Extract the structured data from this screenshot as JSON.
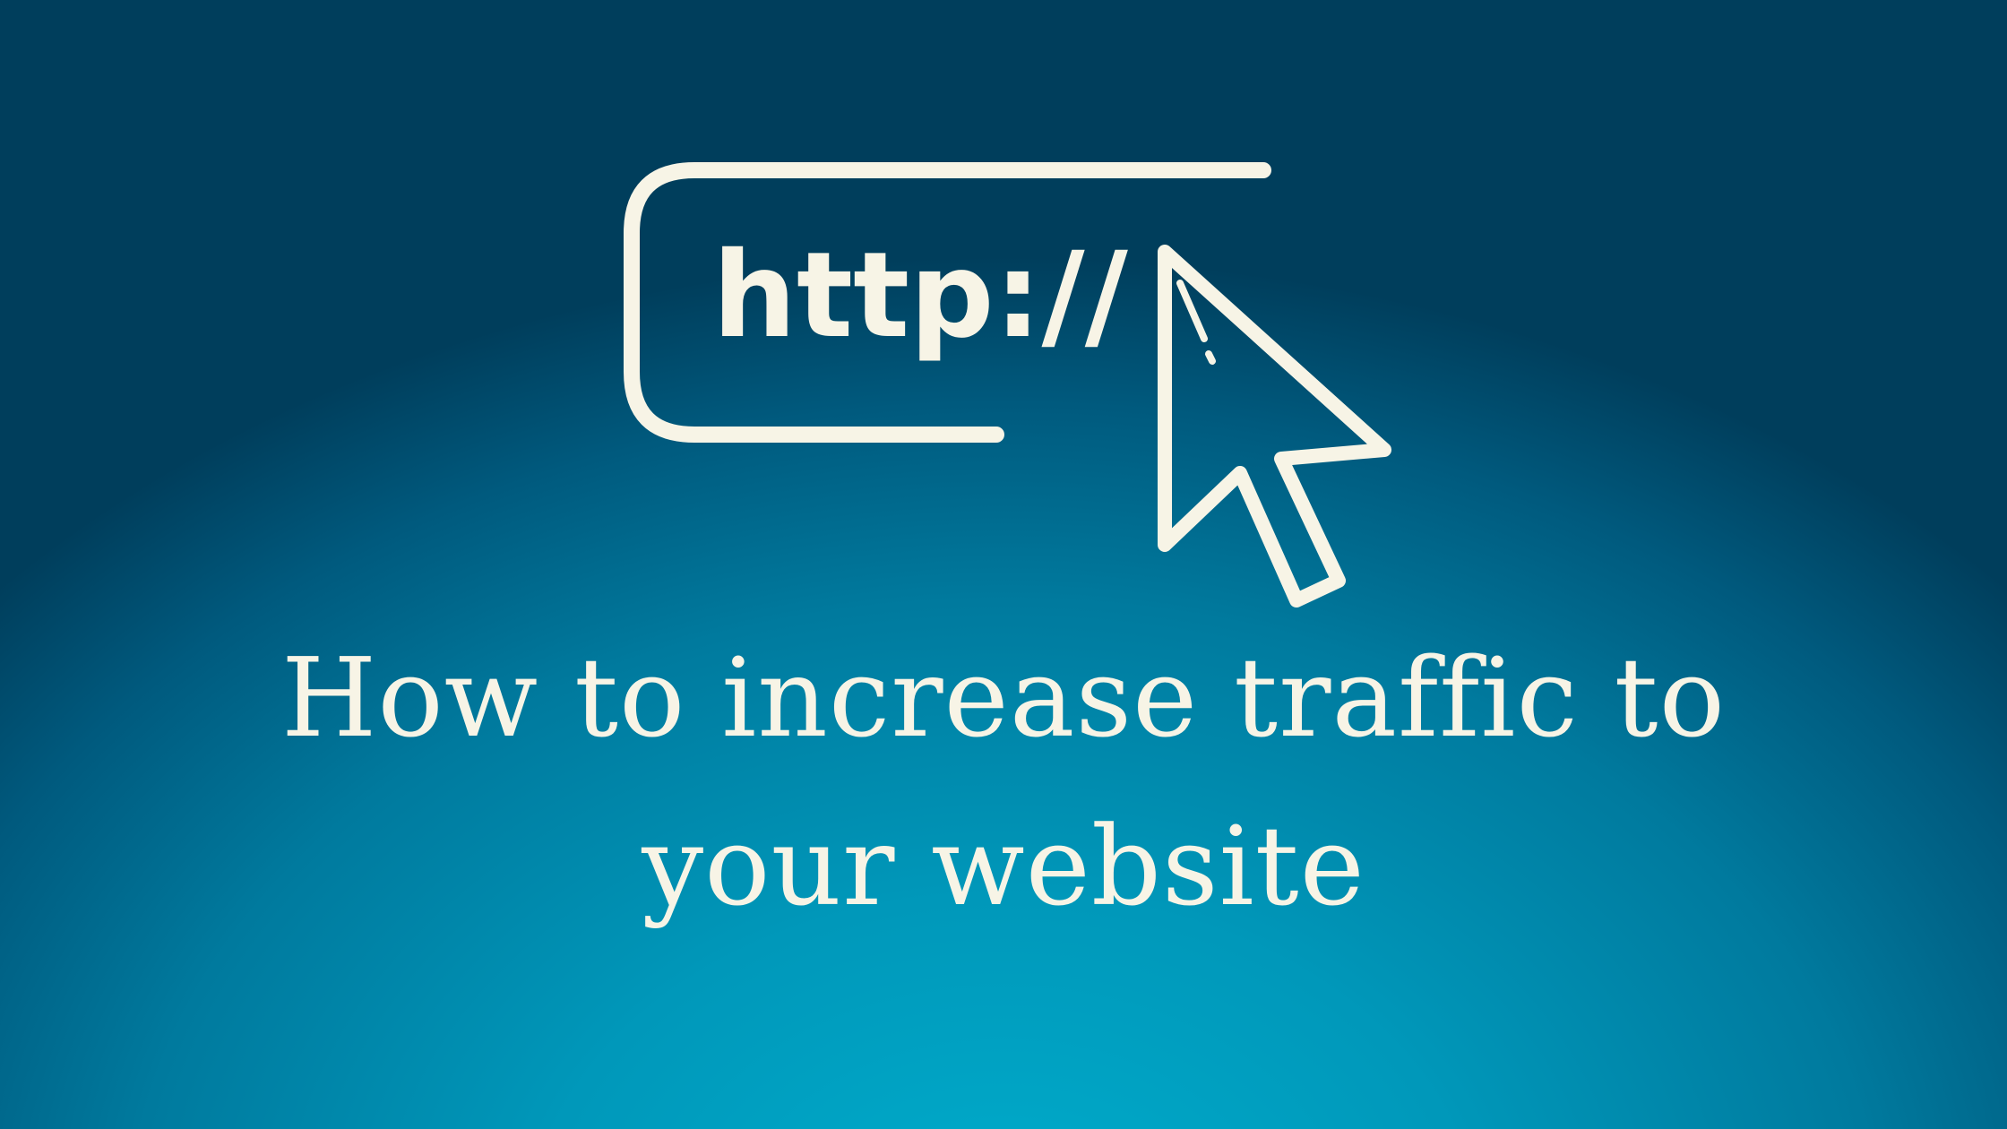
{
  "illustration": {
    "url_text": "http://",
    "address_bar_icon": "address-bar-outline",
    "cursor_icon": "mouse-pointer-arrow"
  },
  "headline": {
    "line1": "How to increase traffic to",
    "line2": "your website"
  },
  "colors": {
    "background_light": "#00adcc",
    "background_dark": "#003e5c",
    "foreground": "#f7f4e6"
  }
}
